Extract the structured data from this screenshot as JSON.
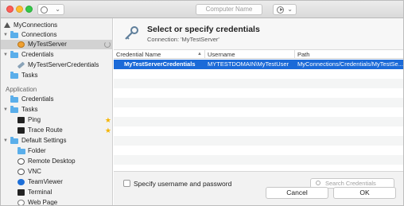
{
  "toolbar": {
    "computer_name_placeholder": "Computer Name"
  },
  "sidebar": {
    "connections_root": "MyConnections",
    "connections_folder": "Connections",
    "connection_item": "MyTestServer",
    "credentials_folder": "Credentials",
    "credential_item": "MyTestServerCredentials",
    "tasks_item": "Tasks",
    "application_section": "Application",
    "app_credentials": "Credentials",
    "app_tasks": "Tasks",
    "ping": "Ping",
    "trace_route": "Trace Route",
    "default_settings": "Default Settings",
    "defaults": [
      "Folder",
      "Remote Desktop",
      "VNC",
      "TeamViewer",
      "Terminal",
      "Web Page"
    ]
  },
  "dialog": {
    "title": "Select or specify credentials",
    "subtitle": "Connection: 'MyTestServer'",
    "columns": [
      "Credential Name",
      "Username",
      "Path"
    ],
    "rows": [
      {
        "name": "MyTestServerCredentials",
        "username": "MYTESTDOMAIN\\MyTestUser",
        "path": "MyConnections/Credentials/MyTestSe..."
      }
    ],
    "checkbox_label": "Specify username and password",
    "search_placeholder": "Search Credentials",
    "cancel_label": "Cancel",
    "ok_label": "OK"
  },
  "colors": {
    "selection": "#1b6ad8",
    "folder": "#5aaeea",
    "star": "#f5b400"
  }
}
